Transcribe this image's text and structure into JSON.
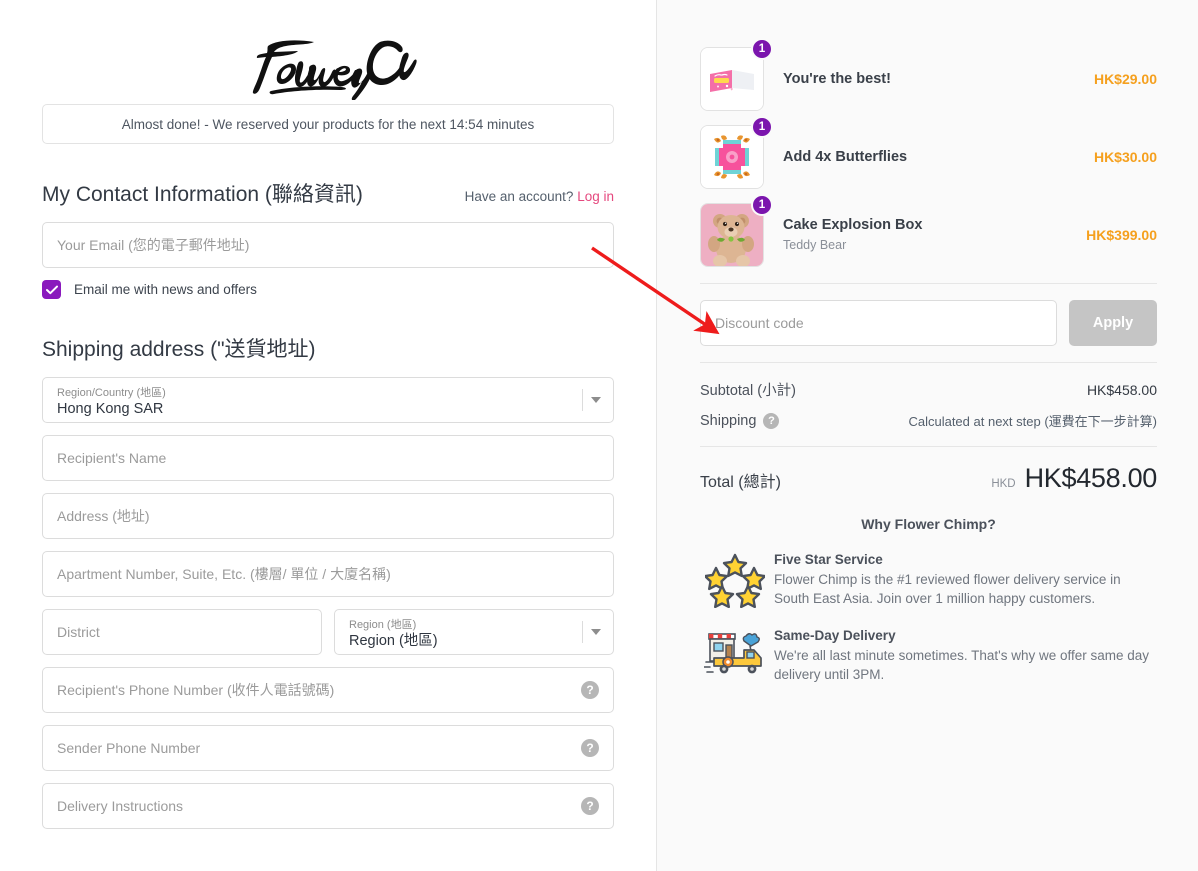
{
  "brand": {
    "logo_text": "FlowerChimp"
  },
  "banner": {
    "text": "Almost done! - We reserved your products for the next 14:54 minutes"
  },
  "contact": {
    "title": "My Contact Information (聯絡資訊)",
    "account_prompt": "Have an account?",
    "login_label": "Log in",
    "email_placeholder": "Your Email (您的電子郵件地址)",
    "newsletter_label": "Email me with news and offers",
    "newsletter_checked": true
  },
  "shipping": {
    "title": "Shipping address (\"送貨地址)",
    "country": {
      "label": "Region/Country (地區)",
      "value": "Hong Kong SAR"
    },
    "recipient_name_placeholder": "Recipient's Name",
    "address_placeholder": "Address (地址)",
    "apartment_placeholder": "Apartment Number, Suite, Etc. (樓層/ 單位 / 大廈名稱)",
    "district_placeholder": "District",
    "region": {
      "label": "Region (地區)",
      "value": "Region (地區)"
    },
    "recipient_phone_placeholder": "Recipient's Phone Number (收件人電話號碼)",
    "sender_phone_placeholder": "Sender Phone Number",
    "delivery_instructions_placeholder": "Delivery Instructions",
    "help_icon": "question-mark-icon"
  },
  "cart": {
    "items": [
      {
        "qty": "1",
        "title": "You're the best!",
        "variant": "",
        "price": "HK$29.00",
        "image": "greeting-card-thumbnail"
      },
      {
        "qty": "1",
        "title": "Add 4x Butterflies",
        "variant": "",
        "price": "HK$30.00",
        "image": "butterfly-box-thumbnail"
      },
      {
        "qty": "1",
        "title": "Cake Explosion Box",
        "variant": "Teddy Bear",
        "price": "HK$399.00",
        "image": "teddy-bear-thumbnail"
      }
    ]
  },
  "discount": {
    "placeholder": "Discount code",
    "apply_label": "Apply"
  },
  "summary": {
    "subtotal_label": "Subtotal (小計)",
    "subtotal_value": "HK$458.00",
    "shipping_label": "Shipping",
    "shipping_value": "Calculated at next step (運費在下一步計算)",
    "total_label": "Total (總計)",
    "currency": "HKD",
    "total_value": "HK$458.00"
  },
  "why": {
    "title": "Why Flower Chimp?",
    "items": [
      {
        "icon": "five-stars-icon",
        "heading": "Five Star Service",
        "body": "Flower Chimp is the #1 reviewed flower delivery service in South East Asia. Join over 1 million happy customers."
      },
      {
        "icon": "delivery-van-icon",
        "heading": "Same-Day Delivery",
        "body": "We're all last minute sometimes. That's why we offer same day delivery until 3PM."
      }
    ]
  },
  "colors": {
    "accent_purple": "#8a19bd",
    "link_pink": "#e5487e",
    "price_orange": "#f5a01e",
    "apply_disabled": "#c5c5c5",
    "annotation_red": "#ee1c1c"
  },
  "annotation": {
    "type": "arrow",
    "points_to": "discount-code-input"
  }
}
